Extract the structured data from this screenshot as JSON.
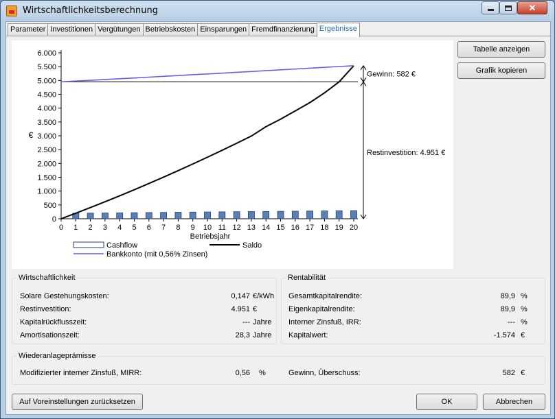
{
  "window": {
    "title": "Wirtschaftlichkeitsberechnung"
  },
  "tabs": [
    {
      "label": "Parameter"
    },
    {
      "label": "Investitionen"
    },
    {
      "label": "Vergütungen"
    },
    {
      "label": "Betriebskosten"
    },
    {
      "label": "Einsparungen"
    },
    {
      "label": "Fremdfinanzierung"
    },
    {
      "label": "Ergebnisse",
      "active": true
    }
  ],
  "buttons": {
    "show_table": "Tabelle anzeigen",
    "copy_chart": "Grafik kopieren",
    "reset": "Auf Voreinstellungen zurücksetzen",
    "ok": "OK",
    "cancel": "Abbrechen"
  },
  "chart_data": {
    "type": "bar",
    "xlabel": "Betriebsjahr",
    "ylabel": "€",
    "ylim": [
      0,
      6000
    ],
    "yticks": [
      "0",
      "500",
      "1.000",
      "1.500",
      "2.000",
      "2.500",
      "3.000",
      "3.500",
      "4.000",
      "4.500",
      "5.000",
      "5.500",
      "6.000"
    ],
    "x": [
      0,
      1,
      2,
      3,
      4,
      5,
      6,
      7,
      8,
      9,
      10,
      11,
      12,
      13,
      14,
      15,
      16,
      17,
      18,
      19,
      20
    ],
    "series": [
      {
        "name": "Cashflow",
        "kind": "bar",
        "color": "#5b7fb5",
        "values": [
          null,
          200,
          205,
          210,
          215,
          220,
          225,
          230,
          235,
          240,
          245,
          250,
          255,
          260,
          265,
          270,
          275,
          280,
          285,
          290,
          295
        ]
      },
      {
        "name": "Saldo",
        "kind": "line",
        "color": "#000000",
        "values": [
          0,
          200,
          405,
          615,
          830,
          1050,
          1275,
          1505,
          1740,
          1980,
          2225,
          2475,
          2730,
          2990,
          3330,
          3600,
          3900,
          4200,
          4550,
          4950,
          5533
        ]
      },
      {
        "name": "Bankkonto (mit 0,56% Zinsen)",
        "kind": "line",
        "color": "#6a5ee8",
        "values": [
          4951,
          4979,
          5007,
          5035,
          5063,
          5091,
          5120,
          5149,
          5178,
          5207,
          5236,
          5265,
          5294,
          5324,
          5354,
          5384,
          5414,
          5444,
          5475,
          5504,
          5533
        ]
      }
    ],
    "reference_line": {
      "value": 4951
    },
    "annotations": [
      {
        "label": "Gewinn: 582 €",
        "from": 4951,
        "to": 5533
      },
      {
        "label": "Restinvestition: 4.951 €",
        "from": 0,
        "to": 4951
      }
    ],
    "legend_position": "bottom"
  },
  "wirtschaftlichkeit": {
    "title": "Wirtschaftlichkeit",
    "rows": [
      {
        "label": "Solare Gestehungskosten:",
        "value": "0,147",
        "unit": "€/kWh"
      },
      {
        "label": "Restinvestition:",
        "value": "4.951",
        "unit": "€"
      },
      {
        "label": "Kapitalrückflusszeit:",
        "value": "---",
        "unit": "Jahre"
      },
      {
        "label": "Amortisationszeit:",
        "value": "28,3",
        "unit": "Jahre"
      }
    ]
  },
  "rentabilitaet": {
    "title": "Rentabilität",
    "rows": [
      {
        "label": "Gesamtkapitalrendite:",
        "value": "89,9",
        "unit": "%"
      },
      {
        "label": "Eigenkapitalrendite:",
        "value": "89,9",
        "unit": "%"
      },
      {
        "label": "Interner Zinsfuß, IRR:",
        "value": "---",
        "unit": "%"
      },
      {
        "label": "Kapitalwert:",
        "value": "-1.574",
        "unit": "€"
      }
    ]
  },
  "wiederanlage": {
    "title": "Wiederanlageprämisse",
    "mirr_label": "Modifizierter interner Zinsfuß, MIRR:",
    "mirr_value": "0,56",
    "mirr_unit": "%",
    "gewinn_label": "Gewinn, Überschuss:",
    "gewinn_value": "582",
    "gewinn_unit": "€"
  }
}
